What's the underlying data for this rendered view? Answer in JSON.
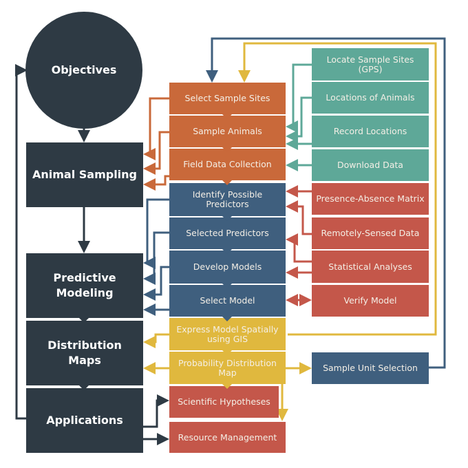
{
  "colors": {
    "dark": "#2e3a44",
    "orange": "#c9693a",
    "blue": "#3f5f7e",
    "yellow": "#e0b83e",
    "red": "#c4574a",
    "teal": "#5ea898"
  },
  "stages": {
    "objectives": "Objectives",
    "animal_sampling": "Animal Sampling",
    "predictive_modeling": "Predictive Modeling",
    "distribution_maps": "Distribution Maps",
    "applications": "Applications"
  },
  "steps": {
    "select_sample_sites": "Select Sample Sites",
    "sample_animals": "Sample Animals",
    "field_data_collection": "Field Data Collection",
    "identify_predictors": "Identify Possible Predictors",
    "selected_predictors": "Selected Predictors",
    "develop_models": "Develop Models",
    "select_model": "Select Model",
    "express_model": "Express Model Spatially using GIS",
    "probability_map": "Probability Distribution Map",
    "scientific_hypotheses": "Scientific Hypotheses",
    "resource_management": "Resource Management"
  },
  "inputs": {
    "locate_sites": "Locate Sample Sites (GPS)",
    "locations_of_animals": "Locations of Animals",
    "record_locations": "Record Locations",
    "download_data": "Download Data",
    "presence_absence": "Presence-Absence Matrix",
    "remotely_sensed": "Remotely-Sensed Data",
    "statistical_analyses": "Statistical Analyses",
    "verify_model": "Verify Model",
    "sample_unit_selection": "Sample Unit Selection"
  }
}
